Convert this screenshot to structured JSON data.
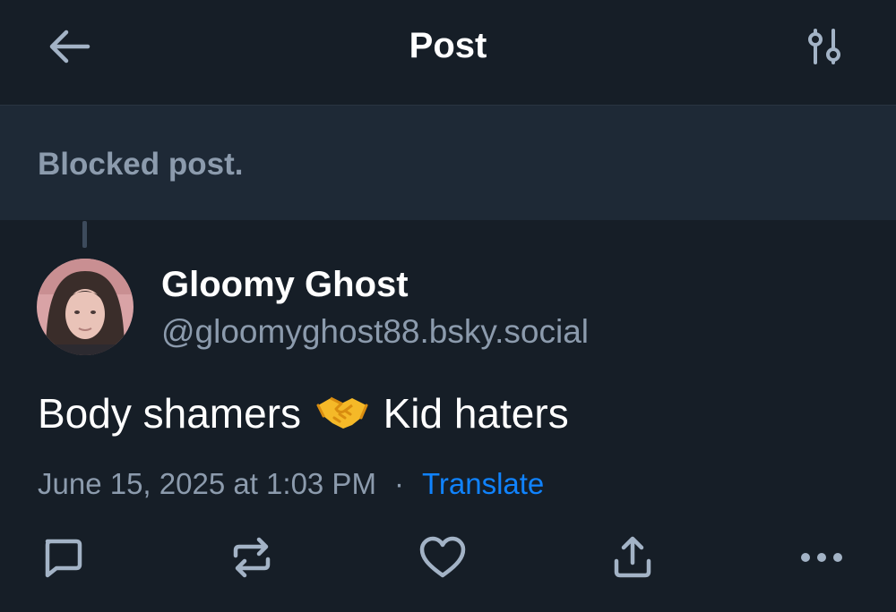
{
  "header": {
    "title": "Post",
    "back_icon": "arrow-left-icon",
    "settings_icon": "sliders-icon"
  },
  "blocked": {
    "text": "Blocked post."
  },
  "post": {
    "author": {
      "display_name": "Gloomy Ghost",
      "handle": "@gloomyghost88.bsky.social"
    },
    "text_before": "Body shamers",
    "emoji": "handshake-emoji",
    "text_after": "Kid haters",
    "timestamp": "June 15, 2025 at 1:03 PM",
    "separator": "·",
    "translate_label": "Translate"
  },
  "actions": {
    "reply_icon": "reply-icon",
    "repost_icon": "repost-icon",
    "like_icon": "heart-icon",
    "share_icon": "share-icon",
    "more_icon": "more-icon"
  },
  "colors": {
    "background": "#161e27",
    "banner": "#1e2936",
    "muted_text": "#8c9bad",
    "link": "#1083fe",
    "icon": "#a3b3c6"
  }
}
